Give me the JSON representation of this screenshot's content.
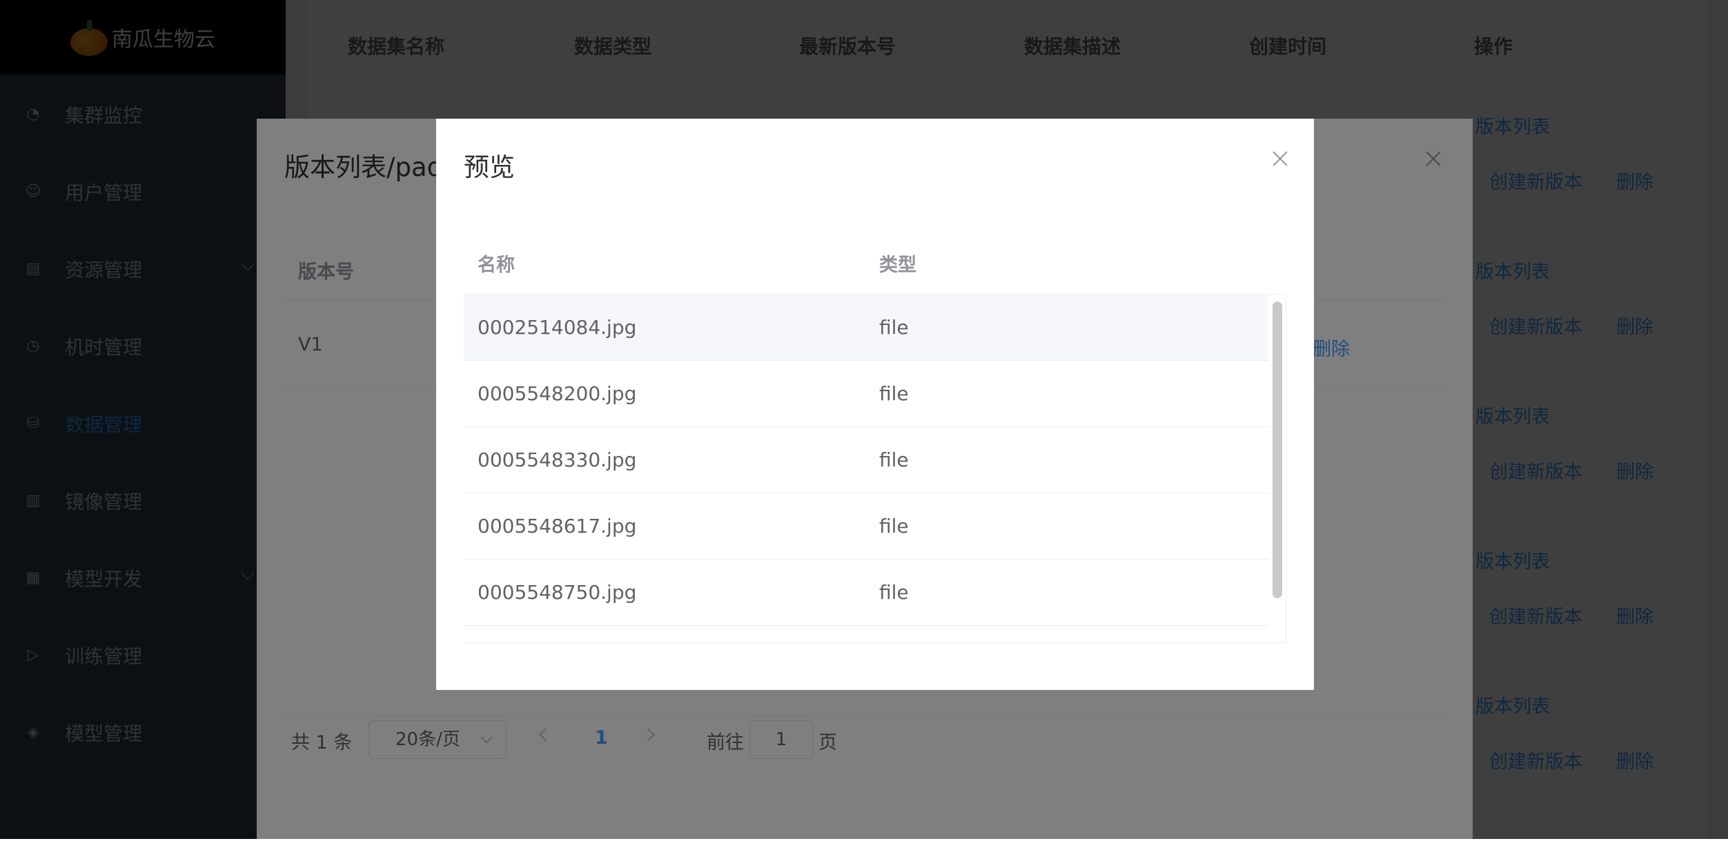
{
  "app": {
    "title": "南瓜生物云"
  },
  "sidebar": {
    "items": [
      {
        "label": "集群监控",
        "icon": "dashboard-icon"
      },
      {
        "label": "用户管理",
        "icon": "user-icon"
      },
      {
        "label": "资源管理",
        "icon": "clipboard-icon",
        "expandable": true
      },
      {
        "label": "机时管理",
        "icon": "clock-icon"
      },
      {
        "label": "数据管理",
        "icon": "database-icon",
        "active": true
      },
      {
        "label": "镜像管理",
        "icon": "image-icon"
      },
      {
        "label": "模型开发",
        "icon": "grid-icon",
        "expandable": true
      },
      {
        "label": "训练管理",
        "icon": "document-icon"
      },
      {
        "label": "模型管理",
        "icon": "layers-icon"
      }
    ]
  },
  "dataset_table": {
    "columns": [
      "数据集名称",
      "数据类型",
      "最新版本号",
      "数据集描述",
      "创建时间",
      "操作"
    ],
    "actions": {
      "versions": "版本列表",
      "new_version": "创建新版本",
      "delete": "删除"
    }
  },
  "version_dialog": {
    "title": "版本列表/pad",
    "column_version": "版本号",
    "rows": [
      {
        "version": "V1",
        "delete": "删除"
      }
    ],
    "pagination": {
      "total": "共 1 条",
      "page_size": "20条/页",
      "current_page": "1",
      "goto_label": "前往",
      "goto_value": "1",
      "page_word": "页"
    }
  },
  "preview_dialog": {
    "title": "预览",
    "columns": [
      "名称",
      "类型"
    ],
    "rows": [
      {
        "name": "0002514084.jpg",
        "type": "file"
      },
      {
        "name": "0005548200.jpg",
        "type": "file"
      },
      {
        "name": "0005548330.jpg",
        "type": "file"
      },
      {
        "name": "0005548617.jpg",
        "type": "file"
      },
      {
        "name": "0005548750.jpg",
        "type": "file"
      }
    ]
  }
}
